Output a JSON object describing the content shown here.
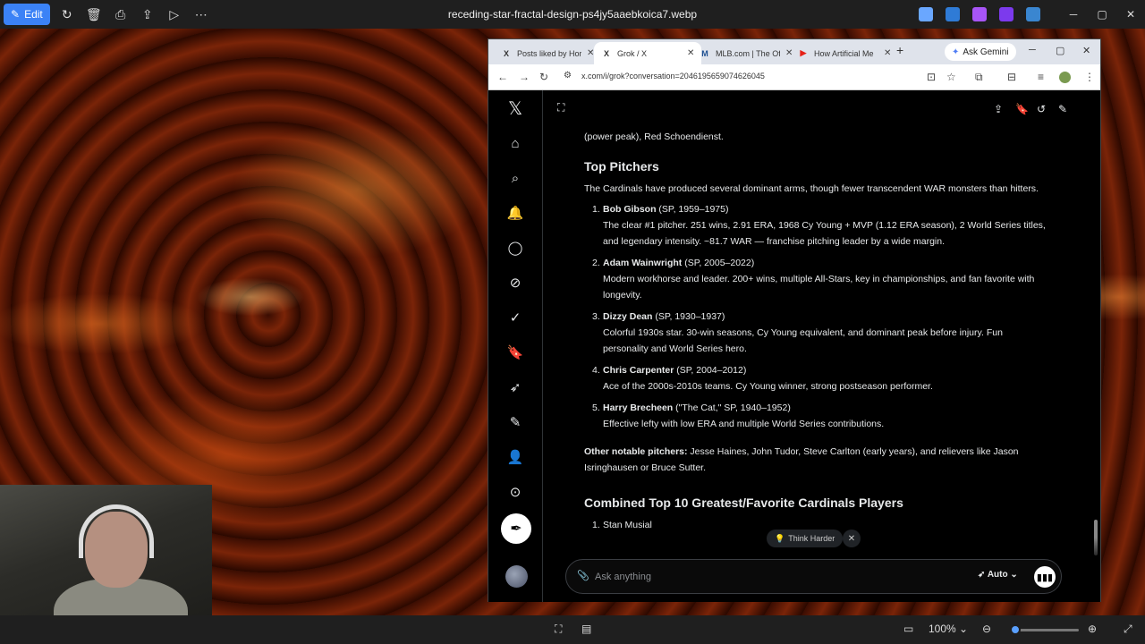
{
  "viewer": {
    "edit_label": "Edit",
    "file_name": "receding-star-fractal-design-ps4jy5aaebkoica7.webp",
    "zoom": "100%"
  },
  "browser": {
    "tabs": [
      {
        "label": "Posts liked by Hor",
        "icon": "X"
      },
      {
        "label": "Grok / X",
        "icon": "X"
      },
      {
        "label": "MLB.com | The Of",
        "icon": "M"
      },
      {
        "label": "How Artificial Me",
        "icon": "▶"
      }
    ],
    "ask_gemini": "Ask Gemini",
    "url": "x.com/i/grok?conversation=2046195659074626045"
  },
  "article": {
    "top_line": "(power peak), Red Schoendienst.",
    "heading": "Top Pitchers",
    "intro": "The Cardinals have produced several dominant arms, though fewer transcendent WAR monsters than hitters.",
    "pitchers": [
      {
        "num": "1.",
        "name": "Bob Gibson",
        "meta": " (SP, 1959–1975)",
        "desc": "The clear #1 pitcher. 251 wins, 2.91 ERA, 1968 Cy Young + MVP (1.12 ERA season), 2 World Series titles, and legendary intensity. ~81.7 WAR — franchise pitching leader by a wide margin."
      },
      {
        "num": "2.",
        "name": "Adam Wainwright",
        "meta": " (SP, 2005–2022)",
        "desc": "Modern workhorse and leader. 200+ wins, multiple All-Stars, key in championships, and fan favorite with longevity."
      },
      {
        "num": "3.",
        "name": "Dizzy Dean",
        "meta": " (SP, 1930–1937)",
        "desc": "Colorful 1930s star. 30-win seasons, Cy Young equivalent, and dominant peak before injury. Fun personality and World Series hero."
      },
      {
        "num": "4.",
        "name": "Chris Carpenter",
        "meta": " (SP, 2004–2012)",
        "desc": "Ace of the 2000s-2010s teams. Cy Young winner, strong postseason performer."
      },
      {
        "num": "5.",
        "name": "Harry Brecheen",
        "meta": " (\"The Cat,\" SP, 1940–1952)",
        "desc": "Effective lefty with low ERA and multiple World Series contributions."
      }
    ],
    "other_label": "Other notable pitchers:",
    "other_text": " Jesse Haines, John Tudor, Steve Carlton (early years), and relievers like Jason Isringhausen or Bruce Sutter.",
    "heading2": "Combined Top 10 Greatest/Favorite Cardinals Players",
    "partial_item": "Stan Musial"
  },
  "composer": {
    "think_harder": "Think Harder",
    "placeholder": "Ask anything",
    "mode": "Auto"
  }
}
